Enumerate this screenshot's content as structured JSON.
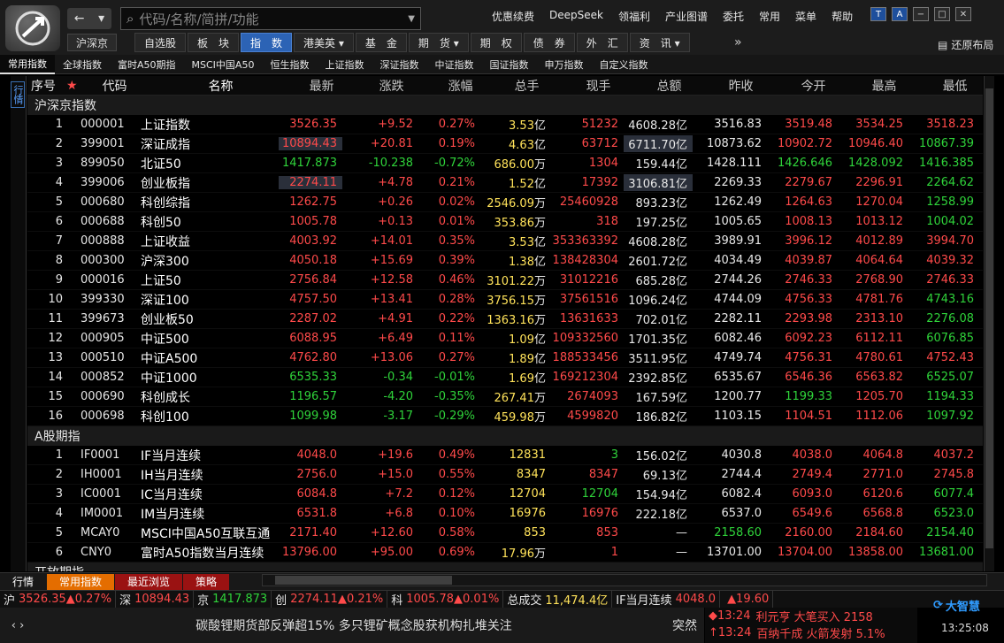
{
  "search": {
    "placeholder": "代码/名称/简拼/功能"
  },
  "nav": {
    "back": "←",
    "dropdown": "▾",
    "market": "沪深京"
  },
  "top_menu": [
    "优惠续费",
    "DeepSeek",
    "领福利",
    "产业图谱",
    "委托",
    "常用",
    "菜单",
    "帮助"
  ],
  "nav_tabs": [
    {
      "label": "自选股",
      "active": false
    },
    {
      "label": "板　块",
      "active": false
    },
    {
      "label": "指　数",
      "active": true
    },
    {
      "label": "港美英 ▾",
      "active": false
    },
    {
      "label": "基　金",
      "active": false
    },
    {
      "label": "期　货 ▾",
      "active": false
    },
    {
      "label": "期　权",
      "active": false
    },
    {
      "label": "债　券",
      "active": false
    },
    {
      "label": "外　汇",
      "active": false
    },
    {
      "label": "资　讯 ▾",
      "active": false
    }
  ],
  "more": "»",
  "restore_layout": "还原布局",
  "sub_tabs": [
    {
      "label": "常用指数",
      "active": true
    },
    {
      "label": "全球指数",
      "active": false
    },
    {
      "label": "富时A50期指",
      "active": false
    },
    {
      "label": "MSCI中国A50",
      "active": false
    },
    {
      "label": "恒生指数",
      "active": false
    },
    {
      "label": "上证指数",
      "active": false
    },
    {
      "label": "深证指数",
      "active": false
    },
    {
      "label": "中证指数",
      "active": false
    },
    {
      "label": "国证指数",
      "active": false
    },
    {
      "label": "申万指数",
      "active": false
    },
    {
      "label": "自定义指数",
      "active": false
    }
  ],
  "side_tab": "行情",
  "columns": [
    "序号",
    "代码",
    "名称",
    "最新",
    "涨跌",
    "涨幅",
    "总手",
    "现手",
    "总额",
    "昨收",
    "今开",
    "最高",
    "最低"
  ],
  "section1_title": "沪深京指数",
  "section1_rows": [
    {
      "no": "1",
      "code": "000001",
      "name": "上证指数",
      "last": "3526.35",
      "chg": "+9.52",
      "pct": "0.27%",
      "vol": "3.53",
      "vol_u": "亿",
      "cur": "51232",
      "amt": "4608.28",
      "amt_u": "亿",
      "prev": "3516.83",
      "open": "3519.48",
      "high": "3534.25",
      "low": "3518.23",
      "dir": "up",
      "hl": false,
      "mark": "☼"
    },
    {
      "no": "2",
      "code": "399001",
      "name": "深证成指",
      "last": "10894.43",
      "chg": "+20.81",
      "pct": "0.19%",
      "vol": "4.63",
      "vol_u": "亿",
      "cur": "63712",
      "amt": "6711.70",
      "amt_u": "亿",
      "prev": "10873.62",
      "open": "10902.72",
      "high": "10946.40",
      "low": "10867.39",
      "dir": "up",
      "hl": true,
      "lowc": "green"
    },
    {
      "no": "3",
      "code": "899050",
      "name": "北证50",
      "last": "1417.873",
      "chg": "-10.238",
      "pct": "-0.72%",
      "vol": "686.00",
      "vol_u": "万",
      "cur": "1304",
      "amt": "159.44",
      "amt_u": "亿",
      "prev": "1428.111",
      "open": "1426.646",
      "high": "1428.092",
      "low": "1416.385",
      "dir": "down",
      "hl": false
    },
    {
      "no": "4",
      "code": "399006",
      "name": "创业板指",
      "last": "2274.11",
      "chg": "+4.78",
      "pct": "0.21%",
      "vol": "1.52",
      "vol_u": "亿",
      "cur": "17392",
      "amt": "3106.81",
      "amt_u": "亿",
      "prev": "2269.33",
      "open": "2279.67",
      "high": "2296.91",
      "low": "2264.62",
      "dir": "up",
      "hl": true,
      "lowc": "green"
    },
    {
      "no": "5",
      "code": "000680",
      "name": "科创综指",
      "last": "1262.75",
      "chg": "+0.26",
      "pct": "0.02%",
      "vol": "2546.09",
      "vol_u": "万",
      "cur": "25460928",
      "amt": "893.23",
      "amt_u": "亿",
      "prev": "1262.49",
      "open": "1264.63",
      "high": "1270.04",
      "low": "1258.99",
      "dir": "up",
      "hl": false,
      "lowc": "green"
    },
    {
      "no": "6",
      "code": "000688",
      "name": "科创50",
      "last": "1005.78",
      "chg": "+0.13",
      "pct": "0.01%",
      "vol": "353.86",
      "vol_u": "万",
      "cur": "318",
      "amt": "197.25",
      "amt_u": "亿",
      "prev": "1005.65",
      "open": "1008.13",
      "high": "1013.12",
      "low": "1004.02",
      "dir": "up",
      "hl": false,
      "lowc": "green"
    },
    {
      "no": "7",
      "code": "000888",
      "name": "上证收益",
      "last": "4003.92",
      "chg": "+14.01",
      "pct": "0.35%",
      "vol": "3.53",
      "vol_u": "亿",
      "cur": "353363392",
      "amt": "4608.28",
      "amt_u": "亿",
      "prev": "3989.91",
      "open": "3996.12",
      "high": "4012.89",
      "low": "3994.70",
      "dir": "up",
      "hl": false
    },
    {
      "no": "8",
      "code": "000300",
      "name": "沪深300",
      "last": "4050.18",
      "chg": "+15.69",
      "pct": "0.39%",
      "vol": "1.38",
      "vol_u": "亿",
      "cur": "138428304",
      "amt": "2601.72",
      "amt_u": "亿",
      "prev": "4034.49",
      "open": "4039.87",
      "high": "4064.64",
      "low": "4039.32",
      "dir": "up",
      "hl": false
    },
    {
      "no": "9",
      "code": "000016",
      "name": "上证50",
      "last": "2756.84",
      "chg": "+12.58",
      "pct": "0.46%",
      "vol": "3101.22",
      "vol_u": "万",
      "cur": "31012216",
      "amt": "685.28",
      "amt_u": "亿",
      "prev": "2744.26",
      "open": "2746.33",
      "high": "2768.90",
      "low": "2746.33",
      "dir": "up",
      "hl": false
    },
    {
      "no": "10",
      "code": "399330",
      "name": "深证100",
      "last": "4757.50",
      "chg": "+13.41",
      "pct": "0.28%",
      "vol": "3756.15",
      "vol_u": "万",
      "cur": "37561516",
      "amt": "1096.24",
      "amt_u": "亿",
      "prev": "4744.09",
      "open": "4756.33",
      "high": "4781.76",
      "low": "4743.16",
      "dir": "up",
      "hl": false,
      "lowc": "green"
    },
    {
      "no": "11",
      "code": "399673",
      "name": "创业板50",
      "last": "2287.02",
      "chg": "+4.91",
      "pct": "0.22%",
      "vol": "1363.16",
      "vol_u": "万",
      "cur": "13631633",
      "amt": "702.01",
      "amt_u": "亿",
      "prev": "2282.11",
      "open": "2293.98",
      "high": "2313.10",
      "low": "2276.08",
      "dir": "up",
      "hl": false,
      "lowc": "green"
    },
    {
      "no": "12",
      "code": "000905",
      "name": "中证500",
      "last": "6088.95",
      "chg": "+6.49",
      "pct": "0.11%",
      "vol": "1.09",
      "vol_u": "亿",
      "cur": "109332560",
      "amt": "1701.35",
      "amt_u": "亿",
      "prev": "6082.46",
      "open": "6092.23",
      "high": "6112.11",
      "low": "6076.85",
      "dir": "up",
      "hl": false,
      "lowc": "green"
    },
    {
      "no": "13",
      "code": "000510",
      "name": "中证A500",
      "last": "4762.80",
      "chg": "+13.06",
      "pct": "0.27%",
      "vol": "1.89",
      "vol_u": "亿",
      "cur": "188533456",
      "amt": "3511.95",
      "amt_u": "亿",
      "prev": "4749.74",
      "open": "4756.31",
      "high": "4780.61",
      "low": "4752.43",
      "dir": "up",
      "hl": false
    },
    {
      "no": "14",
      "code": "000852",
      "name": "中证1000",
      "last": "6535.33",
      "chg": "-0.34",
      "pct": "-0.01%",
      "vol": "1.69",
      "vol_u": "亿",
      "cur": "169212304",
      "amt": "2392.85",
      "amt_u": "亿",
      "prev": "6535.67",
      "open": "6546.36",
      "high": "6563.82",
      "low": "6525.07",
      "dir": "down",
      "hl": false
    },
    {
      "no": "15",
      "code": "000690",
      "name": "科创成长",
      "last": "1196.57",
      "chg": "-4.20",
      "pct": "-0.35%",
      "vol": "267.41",
      "vol_u": "万",
      "cur": "2674093",
      "amt": "167.59",
      "amt_u": "亿",
      "prev": "1200.77",
      "open": "1199.33",
      "high": "1205.70",
      "low": "1194.33",
      "dir": "down",
      "hl": false
    },
    {
      "no": "16",
      "code": "000698",
      "name": "科创100",
      "last": "1099.98",
      "chg": "-3.17",
      "pct": "-0.29%",
      "vol": "459.98",
      "vol_u": "万",
      "cur": "4599820",
      "amt": "186.82",
      "amt_u": "亿",
      "prev": "1103.15",
      "open": "1104.51",
      "high": "1112.06",
      "low": "1097.92",
      "dir": "down",
      "hl": false
    }
  ],
  "section2_title": "A股期指",
  "section2_rows": [
    {
      "no": "1",
      "code": "IF0001",
      "name": "IF当月连续",
      "last": "4048.0",
      "chg": "+19.6",
      "pct": "0.49%",
      "vol": "12831",
      "vol_u": "",
      "cur": "3",
      "amt": "156.02",
      "amt_u": "亿",
      "prev": "4030.8",
      "open": "4038.0",
      "high": "4064.8",
      "low": "4037.2",
      "dir": "up",
      "curc": "green"
    },
    {
      "no": "2",
      "code": "IH0001",
      "name": "IH当月连续",
      "last": "2756.0",
      "chg": "+15.0",
      "pct": "0.55%",
      "vol": "8347",
      "vol_u": "",
      "cur": "8347",
      "amt": "69.13",
      "amt_u": "亿",
      "prev": "2744.4",
      "open": "2749.4",
      "high": "2771.0",
      "low": "2745.8",
      "dir": "up"
    },
    {
      "no": "3",
      "code": "IC0001",
      "name": "IC当月连续",
      "last": "6084.8",
      "chg": "+7.2",
      "pct": "0.12%",
      "vol": "12704",
      "vol_u": "",
      "cur": "12704",
      "amt": "154.94",
      "amt_u": "亿",
      "prev": "6082.4",
      "open": "6093.0",
      "high": "6120.6",
      "low": "6077.4",
      "dir": "up",
      "curc": "green",
      "lowc": "green"
    },
    {
      "no": "4",
      "code": "IM0001",
      "name": "IM当月连续",
      "last": "6531.8",
      "chg": "+6.8",
      "pct": "0.10%",
      "vol": "16976",
      "vol_u": "",
      "cur": "16976",
      "amt": "222.18",
      "amt_u": "亿",
      "prev": "6537.0",
      "open": "6549.6",
      "high": "6568.8",
      "low": "6523.0",
      "dir": "up",
      "lowc": "green"
    },
    {
      "no": "5",
      "code": "MCAY0",
      "name": "MSCI中国A50互联互通",
      "last": "2171.40",
      "chg": "+12.60",
      "pct": "0.58%",
      "vol": "853",
      "vol_u": "",
      "cur": "853",
      "amt": "—",
      "amt_u": "",
      "prev": "2158.60",
      "open": "2160.00",
      "high": "2184.60",
      "low": "2154.40",
      "dir": "up",
      "prevc": "green"
    },
    {
      "no": "6",
      "code": "CNY0",
      "name": "富时A50指数当月连续",
      "last": "13796.00",
      "chg": "+95.00",
      "pct": "0.69%",
      "vol": "17.96",
      "vol_u": "万",
      "cur": "1",
      "amt": "—",
      "amt_u": "",
      "prev": "13701.00",
      "open": "13704.00",
      "high": "13858.00",
      "low": "13681.00",
      "dir": "up"
    }
  ],
  "section3_title": "开放期指",
  "bottom_tabs": [
    "行情",
    "常用指数",
    "最近浏览",
    "策略"
  ],
  "ticker": [
    {
      "label": "沪",
      "value": "3526.35▲0.27%",
      "color": "red"
    },
    {
      "label": "深",
      "value": "10894.43",
      "color": "red"
    },
    {
      "label": "京",
      "value": "1417.873",
      "color": "green"
    },
    {
      "label": "创",
      "value": "2274.11▲0.21%",
      "color": "red"
    },
    {
      "label": "科",
      "value": "1005.78▲0.01%",
      "color": "red"
    },
    {
      "label": "总成交",
      "value": "11,474.4亿",
      "color": "yellow"
    },
    {
      "label": "IF当月连续",
      "value": "4048.0",
      "color": "red"
    },
    {
      "label": "",
      "value": "▲19.60",
      "color": "red"
    }
  ],
  "news": {
    "text": "碳酸锂期货部反弹超15% 多只锂矿概念股获机构扎堆关注",
    "tag": "突然"
  },
  "alerts": [
    {
      "time": "◆13:24",
      "text": "利元亨 大笔买入 2158"
    },
    {
      "time": "↑13:24",
      "text": "百纳千成 火箭发射 5.1%"
    }
  ],
  "brand": "大智慧",
  "clock": "13:25:08",
  "colors": {
    "up": "#ff4a4a",
    "down": "#2fd33a",
    "accent": "#2c63b5",
    "orange": "#e46d00"
  }
}
